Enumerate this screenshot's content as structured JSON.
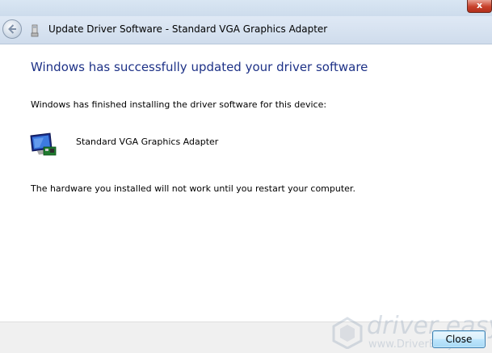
{
  "window": {
    "title": "Update Driver Software - Standard VGA Graphics Adapter",
    "close_glyph": "x"
  },
  "content": {
    "heading": "Windows has successfully updated your driver software",
    "installed_message": "Windows has finished installing the driver software for this device:",
    "device_name": "Standard VGA Graphics Adapter",
    "restart_message": "The hardware you installed will not work until you restart your computer."
  },
  "footer": {
    "close_label": "Close",
    "watermark_text": "driver easy",
    "watermark_url": "www.DriverEasy.com"
  },
  "icons": {
    "back": "back-arrow-icon",
    "device": "device-manager-icon",
    "monitor": "display-adapter-icon"
  },
  "colors": {
    "heading": "#1e3287",
    "header_bar": "#dfe9f5",
    "footer_bar": "#f0f0f0"
  }
}
